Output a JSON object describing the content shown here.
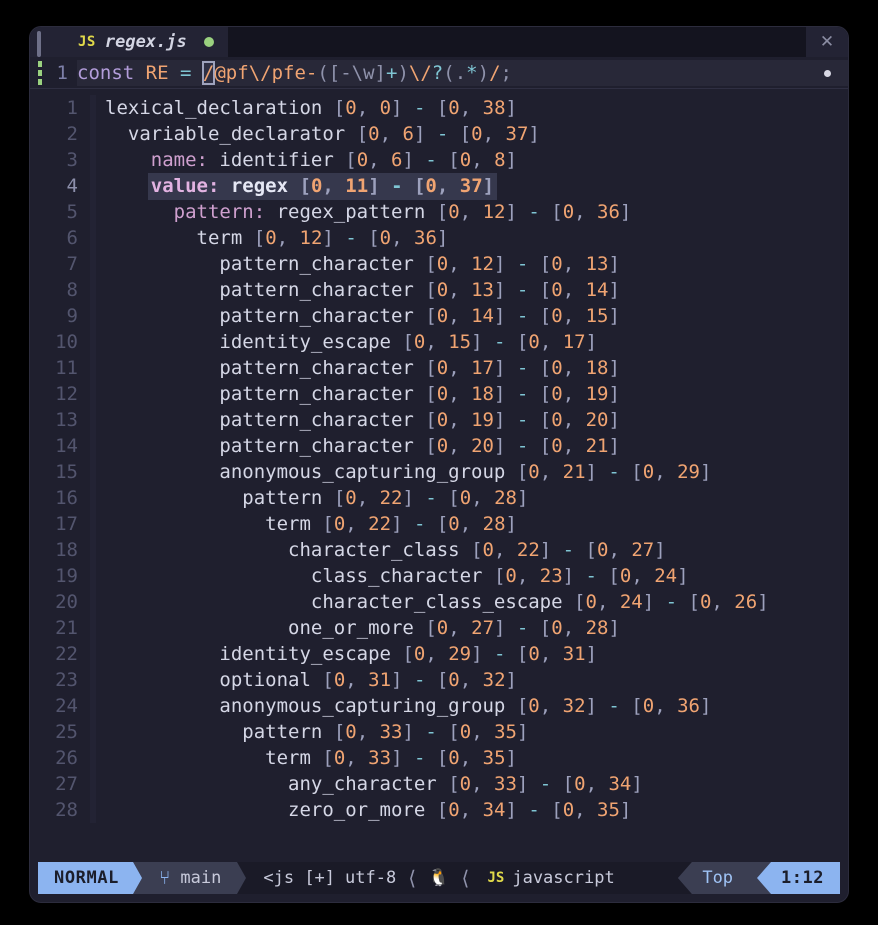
{
  "tab": {
    "lang_badge": "JS",
    "filename": "regex.js",
    "modified_indicator": "●",
    "close_label": "✕"
  },
  "source": {
    "line_number": "1",
    "tokens": [
      {
        "t": "const",
        "c": "sg-kw"
      },
      {
        "t": " ",
        "c": ""
      },
      {
        "t": "RE",
        "c": "sg-var"
      },
      {
        "t": " ",
        "c": ""
      },
      {
        "t": "=",
        "c": "sg-op"
      },
      {
        "t": " ",
        "c": ""
      },
      {
        "t": "/",
        "c": "cursor"
      },
      {
        "t": "@pf",
        "c": "sg-re"
      },
      {
        "t": "\\/",
        "c": "sg-re"
      },
      {
        "t": "pfe-",
        "c": "sg-re"
      },
      {
        "t": "(",
        "c": "sg-punct"
      },
      {
        "t": "[-\\w]",
        "c": "sg-punct"
      },
      {
        "t": "+",
        "c": "sg-q"
      },
      {
        "t": ")",
        "c": "sg-punct"
      },
      {
        "t": "\\/",
        "c": "sg-re"
      },
      {
        "t": "?",
        "c": "sg-q"
      },
      {
        "t": "(",
        "c": "sg-punct"
      },
      {
        "t": ".",
        "c": "sg-punct"
      },
      {
        "t": "*",
        "c": "sg-q"
      },
      {
        "t": ")",
        "c": "sg-punct"
      },
      {
        "t": "/",
        "c": "sg-re"
      },
      {
        "t": ";",
        "c": "sg-punct"
      }
    ],
    "full_text": "const RE = /@pf\\/pfe-([-\\w]+)\\/?(.*)/;"
  },
  "tree": {
    "selected_line": 4,
    "rows": [
      {
        "n": "1",
        "indent": 0,
        "field": "",
        "node": "lexical_declaration",
        "start": "[0, 0]",
        "end": "[0, 38]"
      },
      {
        "n": "2",
        "indent": 1,
        "field": "",
        "node": "variable_declarator",
        "start": "[0, 6]",
        "end": "[0, 37]"
      },
      {
        "n": "3",
        "indent": 2,
        "field": "name: ",
        "node": "identifier",
        "start": "[0, 6]",
        "end": "[0, 8]"
      },
      {
        "n": "4",
        "indent": 2,
        "field": "value: ",
        "node": "regex",
        "start": "[0, 11]",
        "end": "[0, 37]"
      },
      {
        "n": "5",
        "indent": 3,
        "field": "pattern: ",
        "node": "regex_pattern",
        "start": "[0, 12]",
        "end": "[0, 36]"
      },
      {
        "n": "6",
        "indent": 4,
        "field": "",
        "node": "term",
        "start": "[0, 12]",
        "end": "[0, 36]"
      },
      {
        "n": "7",
        "indent": 5,
        "field": "",
        "node": "pattern_character",
        "start": "[0, 12]",
        "end": "[0, 13]"
      },
      {
        "n": "8",
        "indent": 5,
        "field": "",
        "node": "pattern_character",
        "start": "[0, 13]",
        "end": "[0, 14]"
      },
      {
        "n": "9",
        "indent": 5,
        "field": "",
        "node": "pattern_character",
        "start": "[0, 14]",
        "end": "[0, 15]"
      },
      {
        "n": "10",
        "indent": 5,
        "field": "",
        "node": "identity_escape",
        "start": "[0, 15]",
        "end": "[0, 17]"
      },
      {
        "n": "11",
        "indent": 5,
        "field": "",
        "node": "pattern_character",
        "start": "[0, 17]",
        "end": "[0, 18]"
      },
      {
        "n": "12",
        "indent": 5,
        "field": "",
        "node": "pattern_character",
        "start": "[0, 18]",
        "end": "[0, 19]"
      },
      {
        "n": "13",
        "indent": 5,
        "field": "",
        "node": "pattern_character",
        "start": "[0, 19]",
        "end": "[0, 20]"
      },
      {
        "n": "14",
        "indent": 5,
        "field": "",
        "node": "pattern_character",
        "start": "[0, 20]",
        "end": "[0, 21]"
      },
      {
        "n": "15",
        "indent": 5,
        "field": "",
        "node": "anonymous_capturing_group",
        "start": "[0, 21]",
        "end": "[0, 29]"
      },
      {
        "n": "16",
        "indent": 6,
        "field": "",
        "node": "pattern",
        "start": "[0, 22]",
        "end": "[0, 28]"
      },
      {
        "n": "17",
        "indent": 7,
        "field": "",
        "node": "term",
        "start": "[0, 22]",
        "end": "[0, 28]"
      },
      {
        "n": "18",
        "indent": 8,
        "field": "",
        "node": "character_class",
        "start": "[0, 22]",
        "end": "[0, 27]"
      },
      {
        "n": "19",
        "indent": 9,
        "field": "",
        "node": "class_character",
        "start": "[0, 23]",
        "end": "[0, 24]"
      },
      {
        "n": "20",
        "indent": 9,
        "field": "",
        "node": "character_class_escape",
        "start": "[0, 24]",
        "end": "[0, 26]"
      },
      {
        "n": "21",
        "indent": 8,
        "field": "",
        "node": "one_or_more",
        "start": "[0, 27]",
        "end": "[0, 28]"
      },
      {
        "n": "22",
        "indent": 5,
        "field": "",
        "node": "identity_escape",
        "start": "[0, 29]",
        "end": "[0, 31]"
      },
      {
        "n": "23",
        "indent": 5,
        "field": "",
        "node": "optional",
        "start": "[0, 31]",
        "end": "[0, 32]"
      },
      {
        "n": "24",
        "indent": 5,
        "field": "",
        "node": "anonymous_capturing_group",
        "start": "[0, 32]",
        "end": "[0, 36]"
      },
      {
        "n": "25",
        "indent": 6,
        "field": "",
        "node": "pattern",
        "start": "[0, 33]",
        "end": "[0, 35]"
      },
      {
        "n": "26",
        "indent": 7,
        "field": "",
        "node": "term",
        "start": "[0, 33]",
        "end": "[0, 35]"
      },
      {
        "n": "27",
        "indent": 8,
        "field": "",
        "node": "any_character",
        "start": "[0, 33]",
        "end": "[0, 34]"
      },
      {
        "n": "28",
        "indent": 8,
        "field": "",
        "node": "zero_or_more",
        "start": "[0, 34]",
        "end": "[0, 35]"
      }
    ]
  },
  "statusline": {
    "mode": "NORMAL",
    "branch_icon": "⑂",
    "branch": "main",
    "file_info": "<js [+]",
    "encoding": "utf-8",
    "os_icon": "🐧",
    "lang_badge": "JS",
    "language": "javascript",
    "scroll": "Top",
    "position": "1:12"
  },
  "colors": {
    "accent": "#8cb4f0",
    "background": "#1f1f2e",
    "tab_bg": "#1a1a27",
    "selection": "#36384d",
    "number": "#f0a472",
    "field": "#cfa0cf",
    "node": "#d5d7e6",
    "modified": "#9ad17f"
  }
}
